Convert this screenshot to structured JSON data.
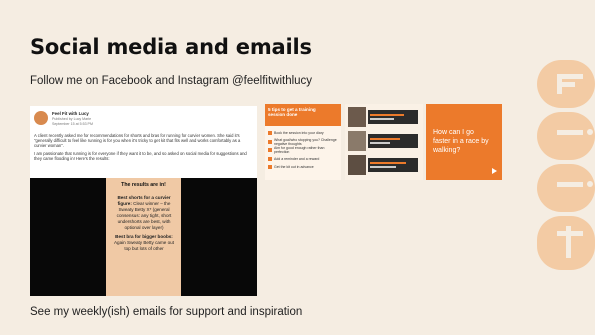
{
  "slide": {
    "title": "Social media and emails",
    "subtitle": "Follow me on Facebook and Instagram @feelfitwithlucy",
    "footer": "See my weekly(ish) emails for support and inspiration"
  },
  "decor": {
    "watermark_text": "FiiT",
    "accent_color": "#ec7a2b",
    "watermark_color": "#f3cba4",
    "background_color": "#f5ede2"
  },
  "facebook_post": {
    "page_name": "Feel Fit with Lucy",
    "published_by": "Published by Lucy Marie",
    "date": "September 15 at 5:53 PM",
    "body_1": "A client recently asked me for recommendations for shorts and bras for running for curvier women. She said it's \"generally difficult to feel like running is for you when it's tricky to get kit that fits well and works comfortably as a curvier woman\".",
    "body_2": "I am passionate that running is for everyone if they want it to be, and so asked on social media for suggestions and they came flooding in! Here's the results:",
    "card": {
      "title": "The results are in!",
      "shorts_heading": "Best shorts for a curvier figure:",
      "shorts_text": "Clear winner – the Sweaty Betty X* (general consensus: any tight, short undershorts are best, with optional over layer)",
      "bra_heading": "Best bra for bigger boobs:",
      "bra_text": "Again Sweaty Betty came out top but lots of other"
    }
  },
  "thumbnails": [
    {
      "title": "5 tips to get a training session done",
      "items": [
        "Book the session into your diary",
        "What goal/who stopping you? Challenge negative thoughts",
        "Aim for good enough rather than perfection",
        "Add a reminder and a reward",
        "Get the kit out in advance"
      ]
    },
    {},
    {
      "text": "How can I go faster in a race by walking?"
    }
  ]
}
